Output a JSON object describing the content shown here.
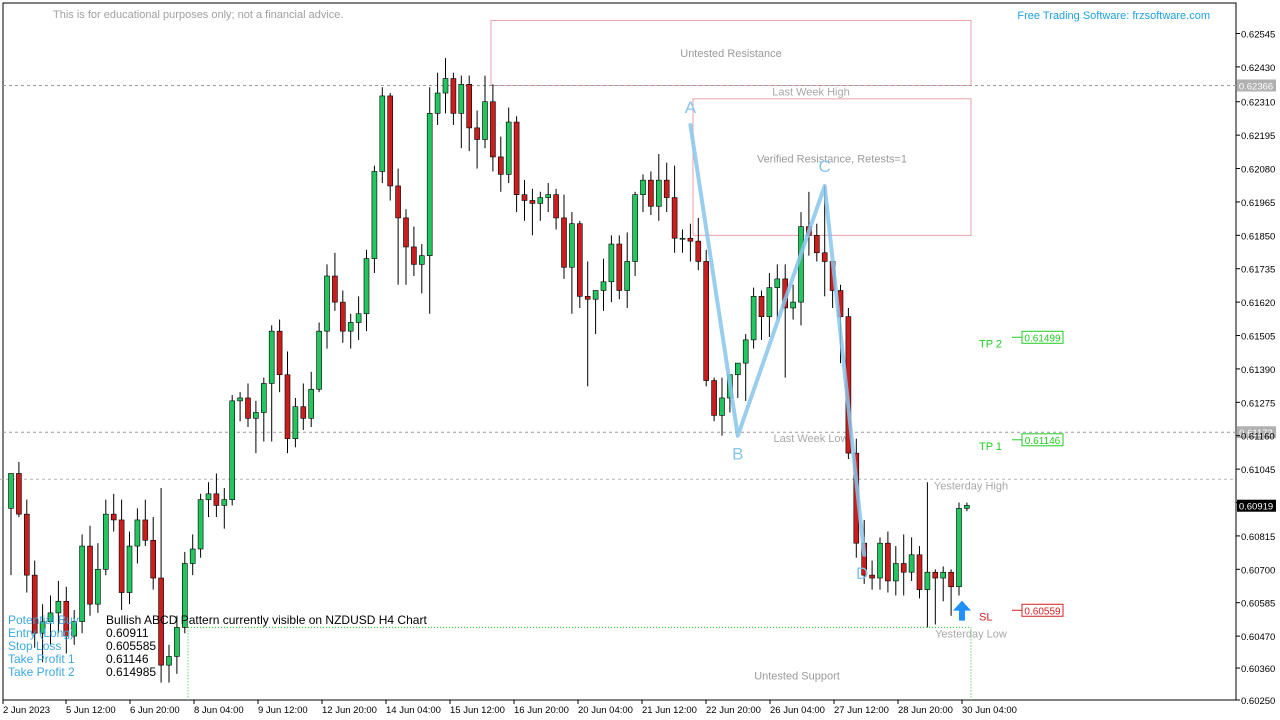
{
  "header": {
    "disclaimer": "This is for educational purposes only; not a financial advice.",
    "software": "Free Trading Software: frzsoftware.com"
  },
  "colors": {
    "bull": "#22c55e",
    "bear": "#c81e1e",
    "abcd": "#87c6ec",
    "zone": "#e8a0a8",
    "tp": "#22cc22",
    "sl": "#d42020",
    "info_label": "#3da8e0",
    "buy_arrow": "#1e90ff"
  },
  "chart_data": {
    "type": "candlestick",
    "symbol": "NZDUSD",
    "timeframe": "H4",
    "ylim": [
      0.6025,
      0.6265
    ],
    "y_ticks": [
      "0.62545",
      "0.62430",
      "0.62310",
      "0.62195",
      "0.62080",
      "0.61965",
      "0.61850",
      "0.61735",
      "0.61620",
      "0.61505",
      "0.61390",
      "0.61275",
      "0.61160",
      "0.61045",
      "0.60930",
      "0.60815",
      "0.60700",
      "0.60585",
      "0.60470",
      "0.60360",
      "0.60250"
    ],
    "x_ticks": [
      "2 Jun 2023",
      "5 Jun 12:00",
      "6 Jun 20:00",
      "8 Jun 04:00",
      "9 Jun 12:00",
      "12 Jun 20:00",
      "14 Jun 04:00",
      "15 Jun 12:00",
      "16 Jun 20:00",
      "20 Jun 04:00",
      "21 Jun 12:00",
      "22 Jun 20:00",
      "26 Jun 04:00",
      "27 Jun 12:00",
      "28 Jun 20:00",
      "30 Jun 04:00"
    ],
    "current_price": "0.60919",
    "candles": [
      [
        0.6091,
        0.6103,
        0.6068,
        0.6103
      ],
      [
        0.6103,
        0.6107,
        0.6088,
        0.6089
      ],
      [
        0.6089,
        0.6094,
        0.6062,
        0.6068
      ],
      [
        0.6068,
        0.6073,
        0.6043,
        0.6048
      ],
      [
        0.6048,
        0.6058,
        0.6038,
        0.6052
      ],
      [
        0.6052,
        0.6061,
        0.6044,
        0.6055
      ],
      [
        0.6055,
        0.6066,
        0.6048,
        0.6059
      ],
      [
        0.6059,
        0.6064,
        0.6041,
        0.6047
      ],
      [
        0.6047,
        0.6056,
        0.6044,
        0.6052
      ],
      [
        0.6052,
        0.6082,
        0.6048,
        0.6078
      ],
      [
        0.6078,
        0.6085,
        0.6054,
        0.6058
      ],
      [
        0.6058,
        0.6079,
        0.6055,
        0.607
      ],
      [
        0.607,
        0.6094,
        0.6068,
        0.6089
      ],
      [
        0.6089,
        0.6096,
        0.6083,
        0.6087
      ],
      [
        0.6087,
        0.6094,
        0.6056,
        0.6062
      ],
      [
        0.6062,
        0.6083,
        0.6058,
        0.6078
      ],
      [
        0.6078,
        0.6091,
        0.6072,
        0.6087
      ],
      [
        0.6087,
        0.6094,
        0.6078,
        0.608
      ],
      [
        0.608,
        0.6088,
        0.6063,
        0.6067
      ],
      [
        0.6067,
        0.6098,
        0.6031,
        0.6037
      ],
      [
        0.6037,
        0.6044,
        0.6031,
        0.604
      ],
      [
        0.604,
        0.6054,
        0.6034,
        0.605
      ],
      [
        0.605,
        0.6076,
        0.6048,
        0.6072
      ],
      [
        0.6072,
        0.6082,
        0.6068,
        0.6077
      ],
      [
        0.6077,
        0.6096,
        0.6074,
        0.6094
      ],
      [
        0.6094,
        0.61,
        0.6088,
        0.6096
      ],
      [
        0.6096,
        0.6103,
        0.6088,
        0.6092
      ],
      [
        0.6092,
        0.6098,
        0.6084,
        0.6094
      ],
      [
        0.6094,
        0.613,
        0.6092,
        0.6128
      ],
      [
        0.6128,
        0.6131,
        0.6121,
        0.6129
      ],
      [
        0.6129,
        0.6134,
        0.6119,
        0.6122
      ],
      [
        0.6122,
        0.6128,
        0.611,
        0.6124
      ],
      [
        0.6124,
        0.6136,
        0.6114,
        0.6134
      ],
      [
        0.6134,
        0.6154,
        0.6114,
        0.6152
      ],
      [
        0.6152,
        0.6156,
        0.6131,
        0.6137
      ],
      [
        0.6137,
        0.6145,
        0.611,
        0.6115
      ],
      [
        0.6115,
        0.6129,
        0.6112,
        0.6126
      ],
      [
        0.6126,
        0.6134,
        0.6118,
        0.6122
      ],
      [
        0.6122,
        0.6138,
        0.6119,
        0.6132
      ],
      [
        0.6132,
        0.6155,
        0.6131,
        0.6152
      ],
      [
        0.6152,
        0.6175,
        0.6146,
        0.6171
      ],
      [
        0.6171,
        0.6179,
        0.6159,
        0.6162
      ],
      [
        0.6162,
        0.6166,
        0.6148,
        0.6152
      ],
      [
        0.6152,
        0.6158,
        0.6146,
        0.6155
      ],
      [
        0.6155,
        0.6164,
        0.6149,
        0.6158
      ],
      [
        0.6158,
        0.618,
        0.6152,
        0.6177
      ],
      [
        0.6177,
        0.6209,
        0.6172,
        0.6207
      ],
      [
        0.6207,
        0.6236,
        0.6203,
        0.6233
      ],
      [
        0.6233,
        0.6234,
        0.6197,
        0.6202
      ],
      [
        0.6202,
        0.6208,
        0.6168,
        0.6191
      ],
      [
        0.6191,
        0.6194,
        0.6168,
        0.6181
      ],
      [
        0.6181,
        0.6188,
        0.6171,
        0.6175
      ],
      [
        0.6175,
        0.6182,
        0.6165,
        0.6178
      ],
      [
        0.6178,
        0.6236,
        0.6158,
        0.6227
      ],
      [
        0.6227,
        0.6241,
        0.6223,
        0.6234
      ],
      [
        0.6234,
        0.6246,
        0.6227,
        0.6239
      ],
      [
        0.6239,
        0.6241,
        0.6223,
        0.6227
      ],
      [
        0.6227,
        0.624,
        0.6215,
        0.6237
      ],
      [
        0.6237,
        0.624,
        0.6214,
        0.6222
      ],
      [
        0.6222,
        0.6228,
        0.6208,
        0.6218
      ],
      [
        0.6218,
        0.624,
        0.6215,
        0.6231
      ],
      [
        0.6231,
        0.6237,
        0.6207,
        0.6212
      ],
      [
        0.6212,
        0.6219,
        0.62,
        0.6206
      ],
      [
        0.6206,
        0.6229,
        0.6203,
        0.6224
      ],
      [
        0.6224,
        0.6226,
        0.6193,
        0.6199
      ],
      [
        0.6199,
        0.6204,
        0.619,
        0.6197
      ],
      [
        0.6197,
        0.6201,
        0.6185,
        0.6196
      ],
      [
        0.6196,
        0.62,
        0.619,
        0.6198
      ],
      [
        0.6198,
        0.6203,
        0.6193,
        0.6199
      ],
      [
        0.6199,
        0.6201,
        0.6187,
        0.6191
      ],
      [
        0.6191,
        0.6199,
        0.617,
        0.6174
      ],
      [
        0.6174,
        0.6193,
        0.6158,
        0.6189
      ],
      [
        0.6189,
        0.619,
        0.616,
        0.6164
      ],
      [
        0.6164,
        0.6176,
        0.6133,
        0.6163
      ],
      [
        0.6163,
        0.6166,
        0.6151,
        0.6166
      ],
      [
        0.6166,
        0.6177,
        0.6159,
        0.6169
      ],
      [
        0.6169,
        0.6185,
        0.6162,
        0.6182
      ],
      [
        0.6182,
        0.6185,
        0.6163,
        0.6166
      ],
      [
        0.6166,
        0.6186,
        0.616,
        0.6176
      ],
      [
        0.6176,
        0.62,
        0.6171,
        0.6199
      ],
      [
        0.6199,
        0.6206,
        0.6193,
        0.6204
      ],
      [
        0.6204,
        0.6207,
        0.6192,
        0.6195
      ],
      [
        0.6195,
        0.6213,
        0.619,
        0.6204
      ],
      [
        0.6204,
        0.621,
        0.6193,
        0.6198
      ],
      [
        0.6198,
        0.6209,
        0.6179,
        0.6184
      ],
      [
        0.6184,
        0.6187,
        0.6179,
        0.6184
      ],
      [
        0.6184,
        0.6189,
        0.6176,
        0.6183
      ],
      [
        0.6183,
        0.6191,
        0.6173,
        0.6176
      ],
      [
        0.6176,
        0.618,
        0.6133,
        0.6135
      ],
      [
        0.6135,
        0.6136,
        0.6121,
        0.6123
      ],
      [
        0.6123,
        0.6136,
        0.6116,
        0.6129
      ],
      [
        0.6129,
        0.613,
        0.6124,
        0.6137
      ],
      [
        0.6137,
        0.6141,
        0.6129,
        0.6141
      ],
      [
        0.6141,
        0.6151,
        0.6128,
        0.6149
      ],
      [
        0.6149,
        0.6167,
        0.6146,
        0.6164
      ],
      [
        0.6164,
        0.6166,
        0.6149,
        0.6157
      ],
      [
        0.6157,
        0.6172,
        0.615,
        0.6167
      ],
      [
        0.6167,
        0.6175,
        0.6156,
        0.617
      ],
      [
        0.617,
        0.6175,
        0.6136,
        0.616
      ],
      [
        0.616,
        0.6168,
        0.6156,
        0.6162
      ],
      [
        0.6162,
        0.6193,
        0.6154,
        0.6188
      ],
      [
        0.6188,
        0.62,
        0.6178,
        0.6185
      ],
      [
        0.6185,
        0.6189,
        0.6176,
        0.6179
      ],
      [
        0.6179,
        0.6202,
        0.6164,
        0.6176
      ],
      [
        0.6176,
        0.6174,
        0.616,
        0.6166
      ],
      [
        0.6166,
        0.6168,
        0.6141,
        0.6157
      ],
      [
        0.6157,
        0.616,
        0.6108,
        0.611
      ],
      [
        0.611,
        0.6115,
        0.6074,
        0.6079
      ],
      [
        0.6079,
        0.6087,
        0.6065,
        0.6068
      ],
      [
        0.6068,
        0.6073,
        0.6063,
        0.6067
      ],
      [
        0.6067,
        0.6081,
        0.6063,
        0.6079
      ],
      [
        0.6079,
        0.6083,
        0.6062,
        0.6066
      ],
      [
        0.6066,
        0.6078,
        0.6061,
        0.6072
      ],
      [
        0.6072,
        0.6082,
        0.6061,
        0.6069
      ],
      [
        0.6069,
        0.6081,
        0.6066,
        0.6075
      ],
      [
        0.6075,
        0.6078,
        0.606,
        0.6063
      ],
      [
        0.6063,
        0.61,
        0.605,
        0.6069
      ],
      [
        0.6069,
        0.607,
        0.6051,
        0.6067
      ],
      [
        0.6067,
        0.6071,
        0.6059,
        0.6069
      ],
      [
        0.6069,
        0.607,
        0.6054,
        0.6064
      ],
      [
        0.6064,
        0.6093,
        0.6061,
        0.6091
      ],
      [
        0.6091,
        0.6093,
        0.609,
        0.6092
      ]
    ],
    "abcd": {
      "A": {
        "label": "A",
        "i": 86,
        "price": 0.6223
      },
      "B": {
        "label": "B",
        "i": 92,
        "price": 0.6116
      },
      "C": {
        "label": "C",
        "i": 103,
        "price": 0.6202
      },
      "D": {
        "label": "D",
        "i": 108,
        "price": 0.6075
      }
    },
    "levels": [
      {
        "name": "last-week-high",
        "label": "Last Week High",
        "price": 0.62366,
        "badge": "0.62366"
      },
      {
        "name": "last-week-low",
        "label": "Last Week Low",
        "price": 0.61172,
        "badge": "0.61172"
      },
      {
        "name": "yesterday-high",
        "label": "Yesterday High",
        "price": 0.6101
      },
      {
        "name": "yesterday-low",
        "label": "Yesterday Low",
        "price": 0.605
      }
    ],
    "zones": [
      {
        "name": "untested-resistance",
        "label": "Untested Resistance",
        "top": 0.6259,
        "bottom": 0.62366
      },
      {
        "name": "verified-resistance",
        "label": "Verified Resistance, Retests=1",
        "top": 0.6232,
        "bottom": 0.6185
      }
    ],
    "untested_support": "Untested Support",
    "targets": [
      {
        "name": "tp2",
        "label": "TP 2",
        "value": "0.61499",
        "price": 0.61499
      },
      {
        "name": "tp1",
        "label": "TP 1",
        "value": "0.61146",
        "price": 0.61146
      },
      {
        "name": "sl",
        "label": "SL",
        "value": "0.60559",
        "price": 0.60559
      }
    ]
  },
  "info": {
    "potential_buy_label": "Potential Buy",
    "potential_buy_value": "Bullish ABCD Pattern currently visible on NZDUSD H4 Chart",
    "entry_label": "Entry (Long)",
    "entry_value": "0.60911",
    "stop_label": "Stop Loss",
    "stop_value": "0.605585",
    "tp1_label": "Take Profit 1",
    "tp1_value": "0.61146",
    "tp2_label": "Take Profit 2",
    "tp2_value": "0.614985"
  }
}
